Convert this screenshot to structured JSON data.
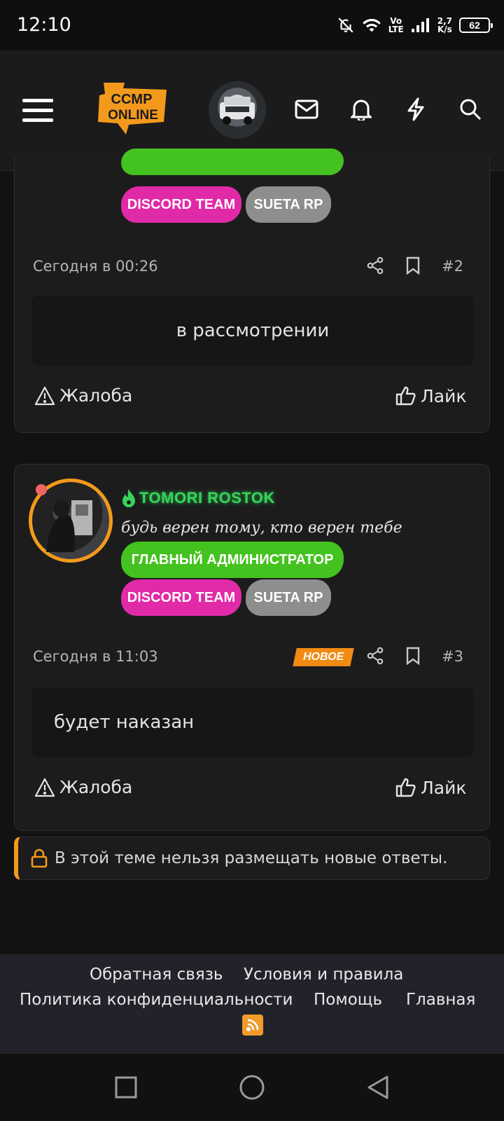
{
  "status_bar": {
    "time": "12:10",
    "network_vo": "Vo",
    "network_lte": "LTE",
    "speed_value": "2,7",
    "speed_unit": "K/s",
    "battery": "62"
  },
  "header": {
    "logo_line1": "CCMP",
    "logo_line2": "ONLINE",
    "icons": [
      "menu-icon",
      "mail-icon",
      "bell-icon",
      "bolt-icon",
      "search-icon"
    ]
  },
  "post2": {
    "badges": [
      "DISCORD TEAM",
      "SUETA RP"
    ],
    "time": "Сегодня в 00:26",
    "number": "#2",
    "message": "в рассмотрении",
    "report_label": "Жалоба",
    "like_label": "Лайк"
  },
  "post3": {
    "username": "TOMORI ROSTOK",
    "user_title": "будь верен тому, кто верен тебе",
    "badges": [
      "ГЛАВНЫЙ АДМИНИСТРАТОР",
      "DISCORD TEAM",
      "SUETA RP"
    ],
    "time": "Сегодня в 11:03",
    "new_tag": "НОВОЕ",
    "number": "#3",
    "message": "будет наказан",
    "report_label": "Жалоба",
    "like_label": "Лайк"
  },
  "thread_closed_notice": "В этой теме нельзя размещать новые ответы.",
  "footer": {
    "links": [
      "Обратная связь",
      "Условия и правила",
      "Политика конфиденциальности",
      "Помощь",
      "Главная"
    ]
  },
  "colors": {
    "accent": "#f39a1c",
    "badge_green": "#44c21f",
    "badge_pink": "#e12aa8",
    "badge_grey": "#8e8e8e",
    "username_green": "#37d45a"
  }
}
